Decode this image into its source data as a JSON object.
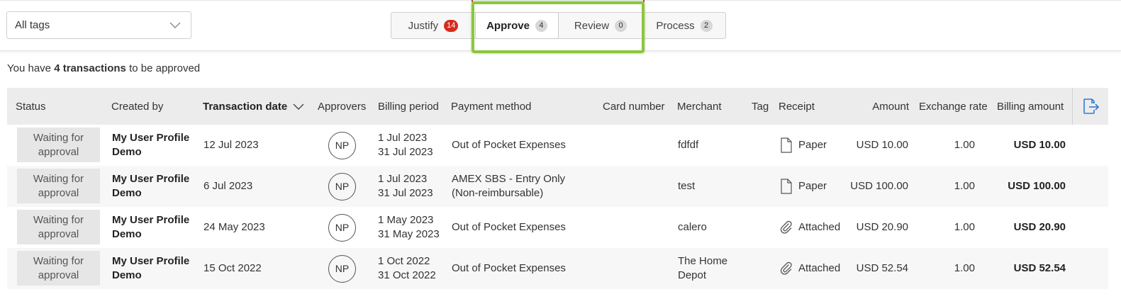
{
  "filter": {
    "value": "All tags"
  },
  "tabs": [
    {
      "label": "Justify",
      "count": "14",
      "active": false
    },
    {
      "label": "Approve",
      "count": "4",
      "active": true
    },
    {
      "label": "Review",
      "count": "0",
      "active": false
    },
    {
      "label": "Process",
      "count": "2",
      "active": false
    }
  ],
  "summary": {
    "prefix": "You have ",
    "count_text": "4 transactions",
    "suffix": " to be approved"
  },
  "columns": {
    "status": "Status",
    "created_by": "Created by",
    "transaction_date": "Transaction date",
    "approvers": "Approvers",
    "billing_period": "Billing period",
    "payment_method": "Payment method",
    "card_number": "Card number",
    "merchant": "Merchant",
    "tag": "Tag",
    "receipt": "Receipt",
    "amount": "Amount",
    "exchange_rate": "Exchange rate",
    "billing_amount": "Billing amount"
  },
  "rows": [
    {
      "status": "Waiting for approval",
      "created_by": "My User Profile Demo",
      "date": "12 Jul 2023",
      "approver": "NP",
      "period_start": "1 Jul 2023",
      "period_end": "31 Jul 2023",
      "payment_method": "Out of Pocket Expenses",
      "card_number": "",
      "merchant": "fdfdf",
      "tag": "",
      "receipt_icon": "document-icon",
      "receipt": "Paper",
      "amount": "USD 10.00",
      "exchange_rate": "1.00",
      "billing_amount": "USD 10.00"
    },
    {
      "status": "Waiting for approval",
      "created_by": "My User Profile Demo",
      "date": "6 Jul 2023",
      "approver": "NP",
      "period_start": "1 Jul 2023",
      "period_end": "31 Jul 2023",
      "payment_method": "AMEX SBS - Entry Only (Non-reimbursable)",
      "card_number": "",
      "merchant": "test",
      "tag": "",
      "receipt_icon": "document-icon",
      "receipt": "Paper",
      "amount": "USD 100.00",
      "exchange_rate": "1.00",
      "billing_amount": "USD 100.00"
    },
    {
      "status": "Waiting for approval",
      "created_by": "My User Profile Demo",
      "date": "24 May 2023",
      "approver": "NP",
      "period_start": "1 May 2023",
      "period_end": "31 May 2023",
      "payment_method": "Out of Pocket Expenses",
      "card_number": "",
      "merchant": "calero",
      "tag": "",
      "receipt_icon": "paperclip-icon",
      "receipt": "Attached",
      "amount": "USD 20.90",
      "exchange_rate": "1.00",
      "billing_amount": "USD 20.90"
    },
    {
      "status": "Waiting for approval",
      "created_by": "My User Profile Demo",
      "date": "15 Oct 2022",
      "approver": "NP",
      "period_start": "1 Oct 2022",
      "period_end": "31 Oct 2022",
      "payment_method": "Out of Pocket Expenses",
      "card_number": "",
      "merchant": "The Home Depot",
      "tag": "",
      "receipt_icon": "paperclip-icon",
      "receipt": "Attached",
      "amount": "USD 52.54",
      "exchange_rate": "1.00",
      "billing_amount": "USD 52.54"
    }
  ],
  "colors": {
    "accent_blue": "#2f7bd6",
    "badge_red": "#d52b1e",
    "highlight_green": "#8cc63f",
    "header_bg": "#ececec"
  }
}
